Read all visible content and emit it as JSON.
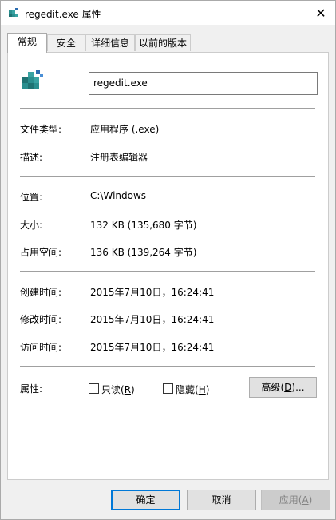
{
  "window": {
    "title": "regedit.exe 属性",
    "close_glyph": "✕"
  },
  "tabs": [
    {
      "label": "常规",
      "active": true
    },
    {
      "label": "安全",
      "active": false
    },
    {
      "label": "详细信息",
      "active": false
    },
    {
      "label": "以前的版本",
      "active": false
    }
  ],
  "general": {
    "file_name": "regedit.exe",
    "file_type_label": "文件类型:",
    "file_type_value": "应用程序 (.exe)",
    "description_label": "描述:",
    "description_value": "注册表编辑器",
    "location_label": "位置:",
    "location_value": "C:\\Windows",
    "size_label": "大小:",
    "size_value": "132 KB (135,680 字节)",
    "size_on_disk_label": "占用空间:",
    "size_on_disk_value": "136 KB (139,264 字节)",
    "created_label": "创建时间:",
    "created_value": "2015年7月10日，16:24:41",
    "modified_label": "修改时间:",
    "modified_value": "2015年7月10日，16:24:41",
    "accessed_label": "访问时间:",
    "accessed_value": "2015年7月10日，16:24:41",
    "attributes_label": "属性:",
    "readonly_text": "只读(",
    "readonly_key": "R",
    "readonly_close": ")",
    "readonly_checked": false,
    "hidden_text": "隐藏(",
    "hidden_key": "H",
    "hidden_close": ")",
    "hidden_checked": false,
    "advanced_text": "高级(",
    "advanced_key": "D",
    "advanced_close": ")..."
  },
  "buttons": {
    "ok": "确定",
    "cancel": "取消",
    "apply_text": "应用(",
    "apply_key": "A",
    "apply_close": ")"
  },
  "colors": {
    "accent": "#0078d7",
    "icon_teal": "#2a8f8f",
    "icon_blue": "#2b6cb0"
  },
  "icons": {
    "title": "registry-editor-icon",
    "file": "registry-editor-icon",
    "close": "close-icon"
  }
}
